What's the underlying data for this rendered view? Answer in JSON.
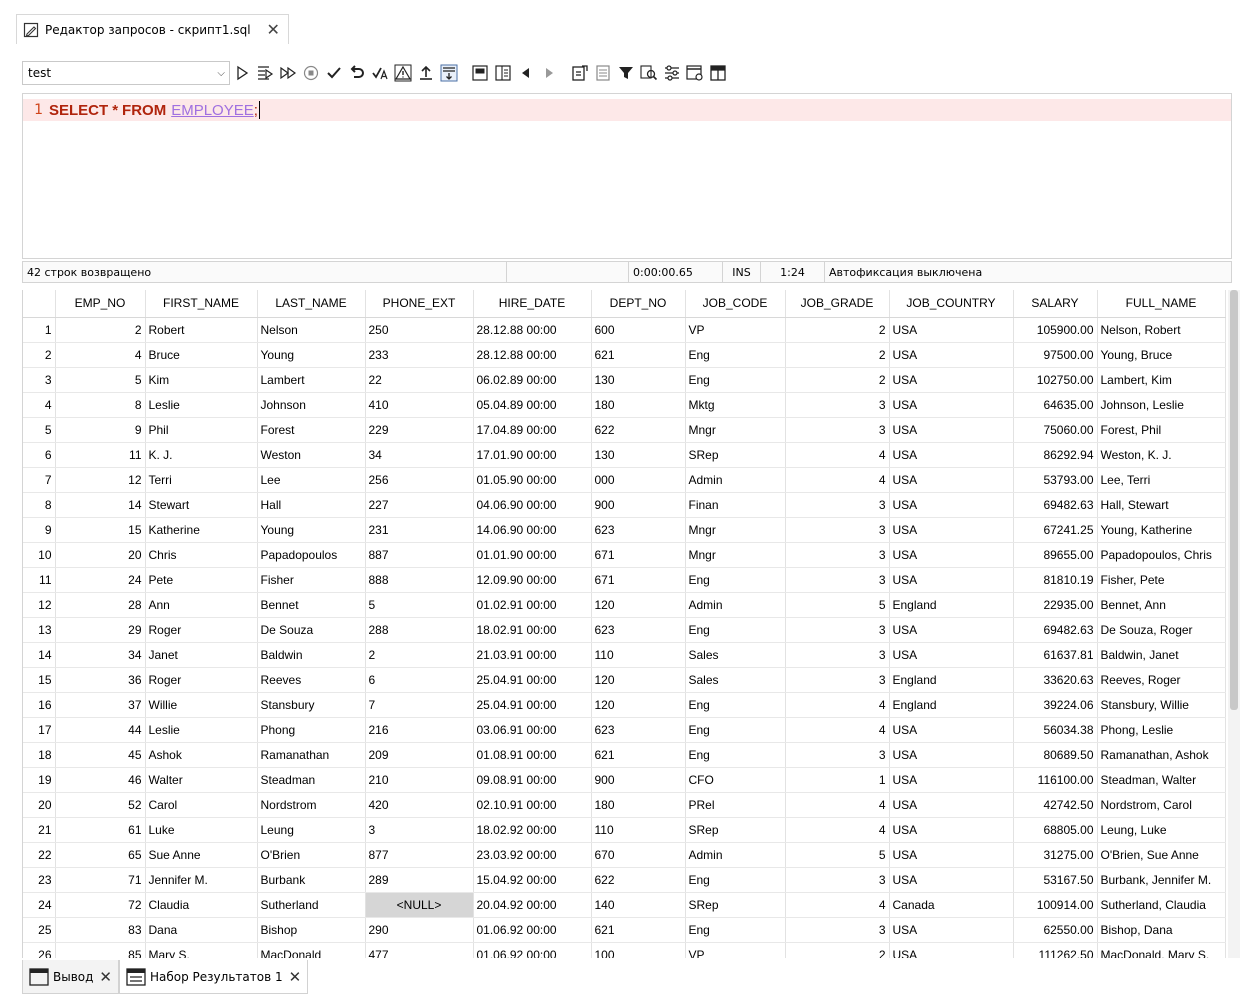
{
  "editor_tab": {
    "title": "Редактор запросов - скрипт1.sql"
  },
  "toolbar": {
    "connection": "test"
  },
  "editor": {
    "line_number": "1",
    "kw_select": "SELECT",
    "kw_star": "*",
    "kw_from": "FROM",
    "table": "EMPLOYEE",
    "semicolon": ";"
  },
  "status": {
    "rows_returned": "42 строк возвращено",
    "time": "0:00:00.65",
    "mode": "INS",
    "position": "1:24",
    "autocommit": "Автофиксация выключена"
  },
  "grid": {
    "columns": [
      "EMP_NO",
      "FIRST_NAME",
      "LAST_NAME",
      "PHONE_EXT",
      "HIRE_DATE",
      "DEPT_NO",
      "JOB_CODE",
      "JOB_GRADE",
      "JOB_COUNTRY",
      "SALARY",
      "FULL_NAME"
    ],
    "rows": [
      [
        "1",
        "2",
        "Robert",
        "Nelson",
        "250",
        "28.12.88 00:00",
        "600",
        "VP",
        "2",
        "USA",
        "105900.00",
        "Nelson, Robert"
      ],
      [
        "2",
        "4",
        "Bruce",
        "Young",
        "233",
        "28.12.88 00:00",
        "621",
        "Eng",
        "2",
        "USA",
        "97500.00",
        "Young, Bruce"
      ],
      [
        "3",
        "5",
        "Kim",
        "Lambert",
        "22",
        "06.02.89 00:00",
        "130",
        "Eng",
        "2",
        "USA",
        "102750.00",
        "Lambert, Kim"
      ],
      [
        "4",
        "8",
        "Leslie",
        "Johnson",
        "410",
        "05.04.89 00:00",
        "180",
        "Mktg",
        "3",
        "USA",
        "64635.00",
        "Johnson, Leslie"
      ],
      [
        "5",
        "9",
        "Phil",
        "Forest",
        "229",
        "17.04.89 00:00",
        "622",
        "Mngr",
        "3",
        "USA",
        "75060.00",
        "Forest, Phil"
      ],
      [
        "6",
        "11",
        "K. J.",
        "Weston",
        "34",
        "17.01.90 00:00",
        "130",
        "SRep",
        "4",
        "USA",
        "86292.94",
        "Weston, K. J."
      ],
      [
        "7",
        "12",
        "Terri",
        "Lee",
        "256",
        "01.05.90 00:00",
        "000",
        "Admin",
        "4",
        "USA",
        "53793.00",
        "Lee, Terri"
      ],
      [
        "8",
        "14",
        "Stewart",
        "Hall",
        "227",
        "04.06.90 00:00",
        "900",
        "Finan",
        "3",
        "USA",
        "69482.63",
        "Hall, Stewart"
      ],
      [
        "9",
        "15",
        "Katherine",
        "Young",
        "231",
        "14.06.90 00:00",
        "623",
        "Mngr",
        "3",
        "USA",
        "67241.25",
        "Young, Katherine"
      ],
      [
        "10",
        "20",
        "Chris",
        "Papadopoulos",
        "887",
        "01.01.90 00:00",
        "671",
        "Mngr",
        "3",
        "USA",
        "89655.00",
        "Papadopoulos, Chris"
      ],
      [
        "11",
        "24",
        "Pete",
        "Fisher",
        "888",
        "12.09.90 00:00",
        "671",
        "Eng",
        "3",
        "USA",
        "81810.19",
        "Fisher, Pete"
      ],
      [
        "12",
        "28",
        "Ann",
        "Bennet",
        "5",
        "01.02.91 00:00",
        "120",
        "Admin",
        "5",
        "England",
        "22935.00",
        "Bennet, Ann"
      ],
      [
        "13",
        "29",
        "Roger",
        "De Souza",
        "288",
        "18.02.91 00:00",
        "623",
        "Eng",
        "3",
        "USA",
        "69482.63",
        "De Souza, Roger"
      ],
      [
        "14",
        "34",
        "Janet",
        "Baldwin",
        "2",
        "21.03.91 00:00",
        "110",
        "Sales",
        "3",
        "USA",
        "61637.81",
        "Baldwin, Janet"
      ],
      [
        "15",
        "36",
        "Roger",
        "Reeves",
        "6",
        "25.04.91 00:00",
        "120",
        "Sales",
        "3",
        "England",
        "33620.63",
        "Reeves, Roger"
      ],
      [
        "16",
        "37",
        "Willie",
        "Stansbury",
        "7",
        "25.04.91 00:00",
        "120",
        "Eng",
        "4",
        "England",
        "39224.06",
        "Stansbury, Willie"
      ],
      [
        "17",
        "44",
        "Leslie",
        "Phong",
        "216",
        "03.06.91 00:00",
        "623",
        "Eng",
        "4",
        "USA",
        "56034.38",
        "Phong, Leslie"
      ],
      [
        "18",
        "45",
        "Ashok",
        "Ramanathan",
        "209",
        "01.08.91 00:00",
        "621",
        "Eng",
        "3",
        "USA",
        "80689.50",
        "Ramanathan, Ashok"
      ],
      [
        "19",
        "46",
        "Walter",
        "Steadman",
        "210",
        "09.08.91 00:00",
        "900",
        "CFO",
        "1",
        "USA",
        "116100.00",
        "Steadman, Walter"
      ],
      [
        "20",
        "52",
        "Carol",
        "Nordstrom",
        "420",
        "02.10.91 00:00",
        "180",
        "PRel",
        "4",
        "USA",
        "42742.50",
        "Nordstrom, Carol"
      ],
      [
        "21",
        "61",
        "Luke",
        "Leung",
        "3",
        "18.02.92 00:00",
        "110",
        "SRep",
        "4",
        "USA",
        "68805.00",
        "Leung, Luke"
      ],
      [
        "22",
        "65",
        "Sue Anne",
        "O'Brien",
        "877",
        "23.03.92 00:00",
        "670",
        "Admin",
        "5",
        "USA",
        "31275.00",
        "O'Brien, Sue Anne"
      ],
      [
        "23",
        "71",
        "Jennifer M.",
        "Burbank",
        "289",
        "15.04.92 00:00",
        "622",
        "Eng",
        "3",
        "USA",
        "53167.50",
        "Burbank, Jennifer M."
      ],
      [
        "24",
        "72",
        "Claudia",
        "Sutherland",
        "<NULL>",
        "20.04.92 00:00",
        "140",
        "SRep",
        "4",
        "Canada",
        "100914.00",
        "Sutherland, Claudia"
      ],
      [
        "25",
        "83",
        "Dana",
        "Bishop",
        "290",
        "01.06.92 00:00",
        "621",
        "Eng",
        "3",
        "USA",
        "62550.00",
        "Bishop, Dana"
      ],
      [
        "26",
        "85",
        "Mary S.",
        "MacDonald",
        "477",
        "01.06.92 00:00",
        "100",
        "VP",
        "2",
        "USA",
        "111262.50",
        "MacDonald, Mary S."
      ]
    ]
  },
  "bottom_tabs": {
    "output": "Вывод",
    "resultset": "Набор Результатов 1"
  }
}
